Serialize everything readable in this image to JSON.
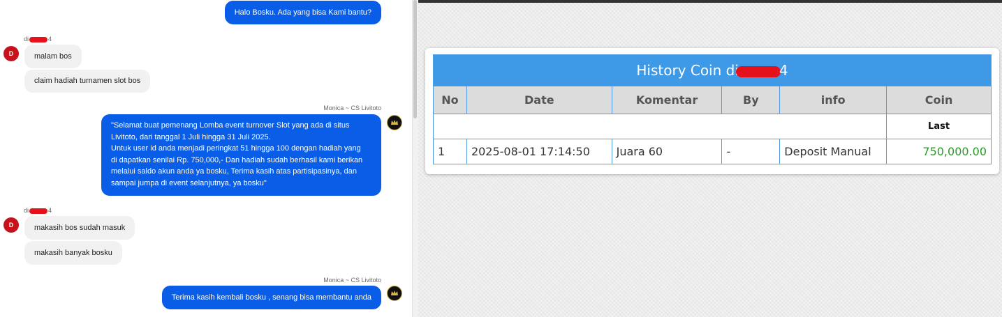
{
  "chat": {
    "messages": [
      {
        "text": "Halo Bosku. Ada yang bisa Kami bantu?"
      },
      {
        "sender_prefix": "di",
        "sender_suffix": "4",
        "avatar": "D",
        "lines": [
          "malam bos",
          "claim hadiah turnamen slot bos"
        ]
      },
      {
        "sender": "Monica ~ CS Livitoto",
        "lines": [
          "\"Selamat buat pemenang Lomba event turnover Slot yang ada di situs",
          "Livitoto, dari tanggal 1 Juli hingga 31 Juli 2025.",
          "Untuk user id anda menjadi peringkat 51 hingga 100 dengan hadiah yang",
          "di dapatkan senilai Rp. 750,000,- Dan hadiah sudah berhasil kami berikan",
          "melalui saldo akun anda ya bosku, Terima kasih atas partisipasinya, dan",
          "sampai jumpa di event selanjutnya, ya bosku\""
        ]
      },
      {
        "sender_prefix": "di",
        "sender_suffix": "4",
        "avatar": "D",
        "lines": [
          "makasih bos sudah masuk",
          "makasih banyak bosku"
        ]
      },
      {
        "sender": "Monica ~ CS Livitoto",
        "text": "Terima kasih kembali bosku , senang bisa membantu anda"
      }
    ]
  },
  "history": {
    "title_prefix": "History Coin di",
    "title_suffix": "4",
    "headers": [
      "No",
      "Date",
      "Komentar",
      "By",
      "info",
      "Coin"
    ],
    "last_label": "Last",
    "rows": [
      {
        "no": "1",
        "date": "2025-08-01 17:14:50",
        "komentar": "Juara 60",
        "by": "-",
        "info": "Deposit Manual",
        "coin": "750,000.00"
      }
    ]
  },
  "colors": {
    "outgoing_bubble": "#0a5de6",
    "header_blue": "#3e9ae6",
    "coin_green": "#2a9a2a"
  }
}
